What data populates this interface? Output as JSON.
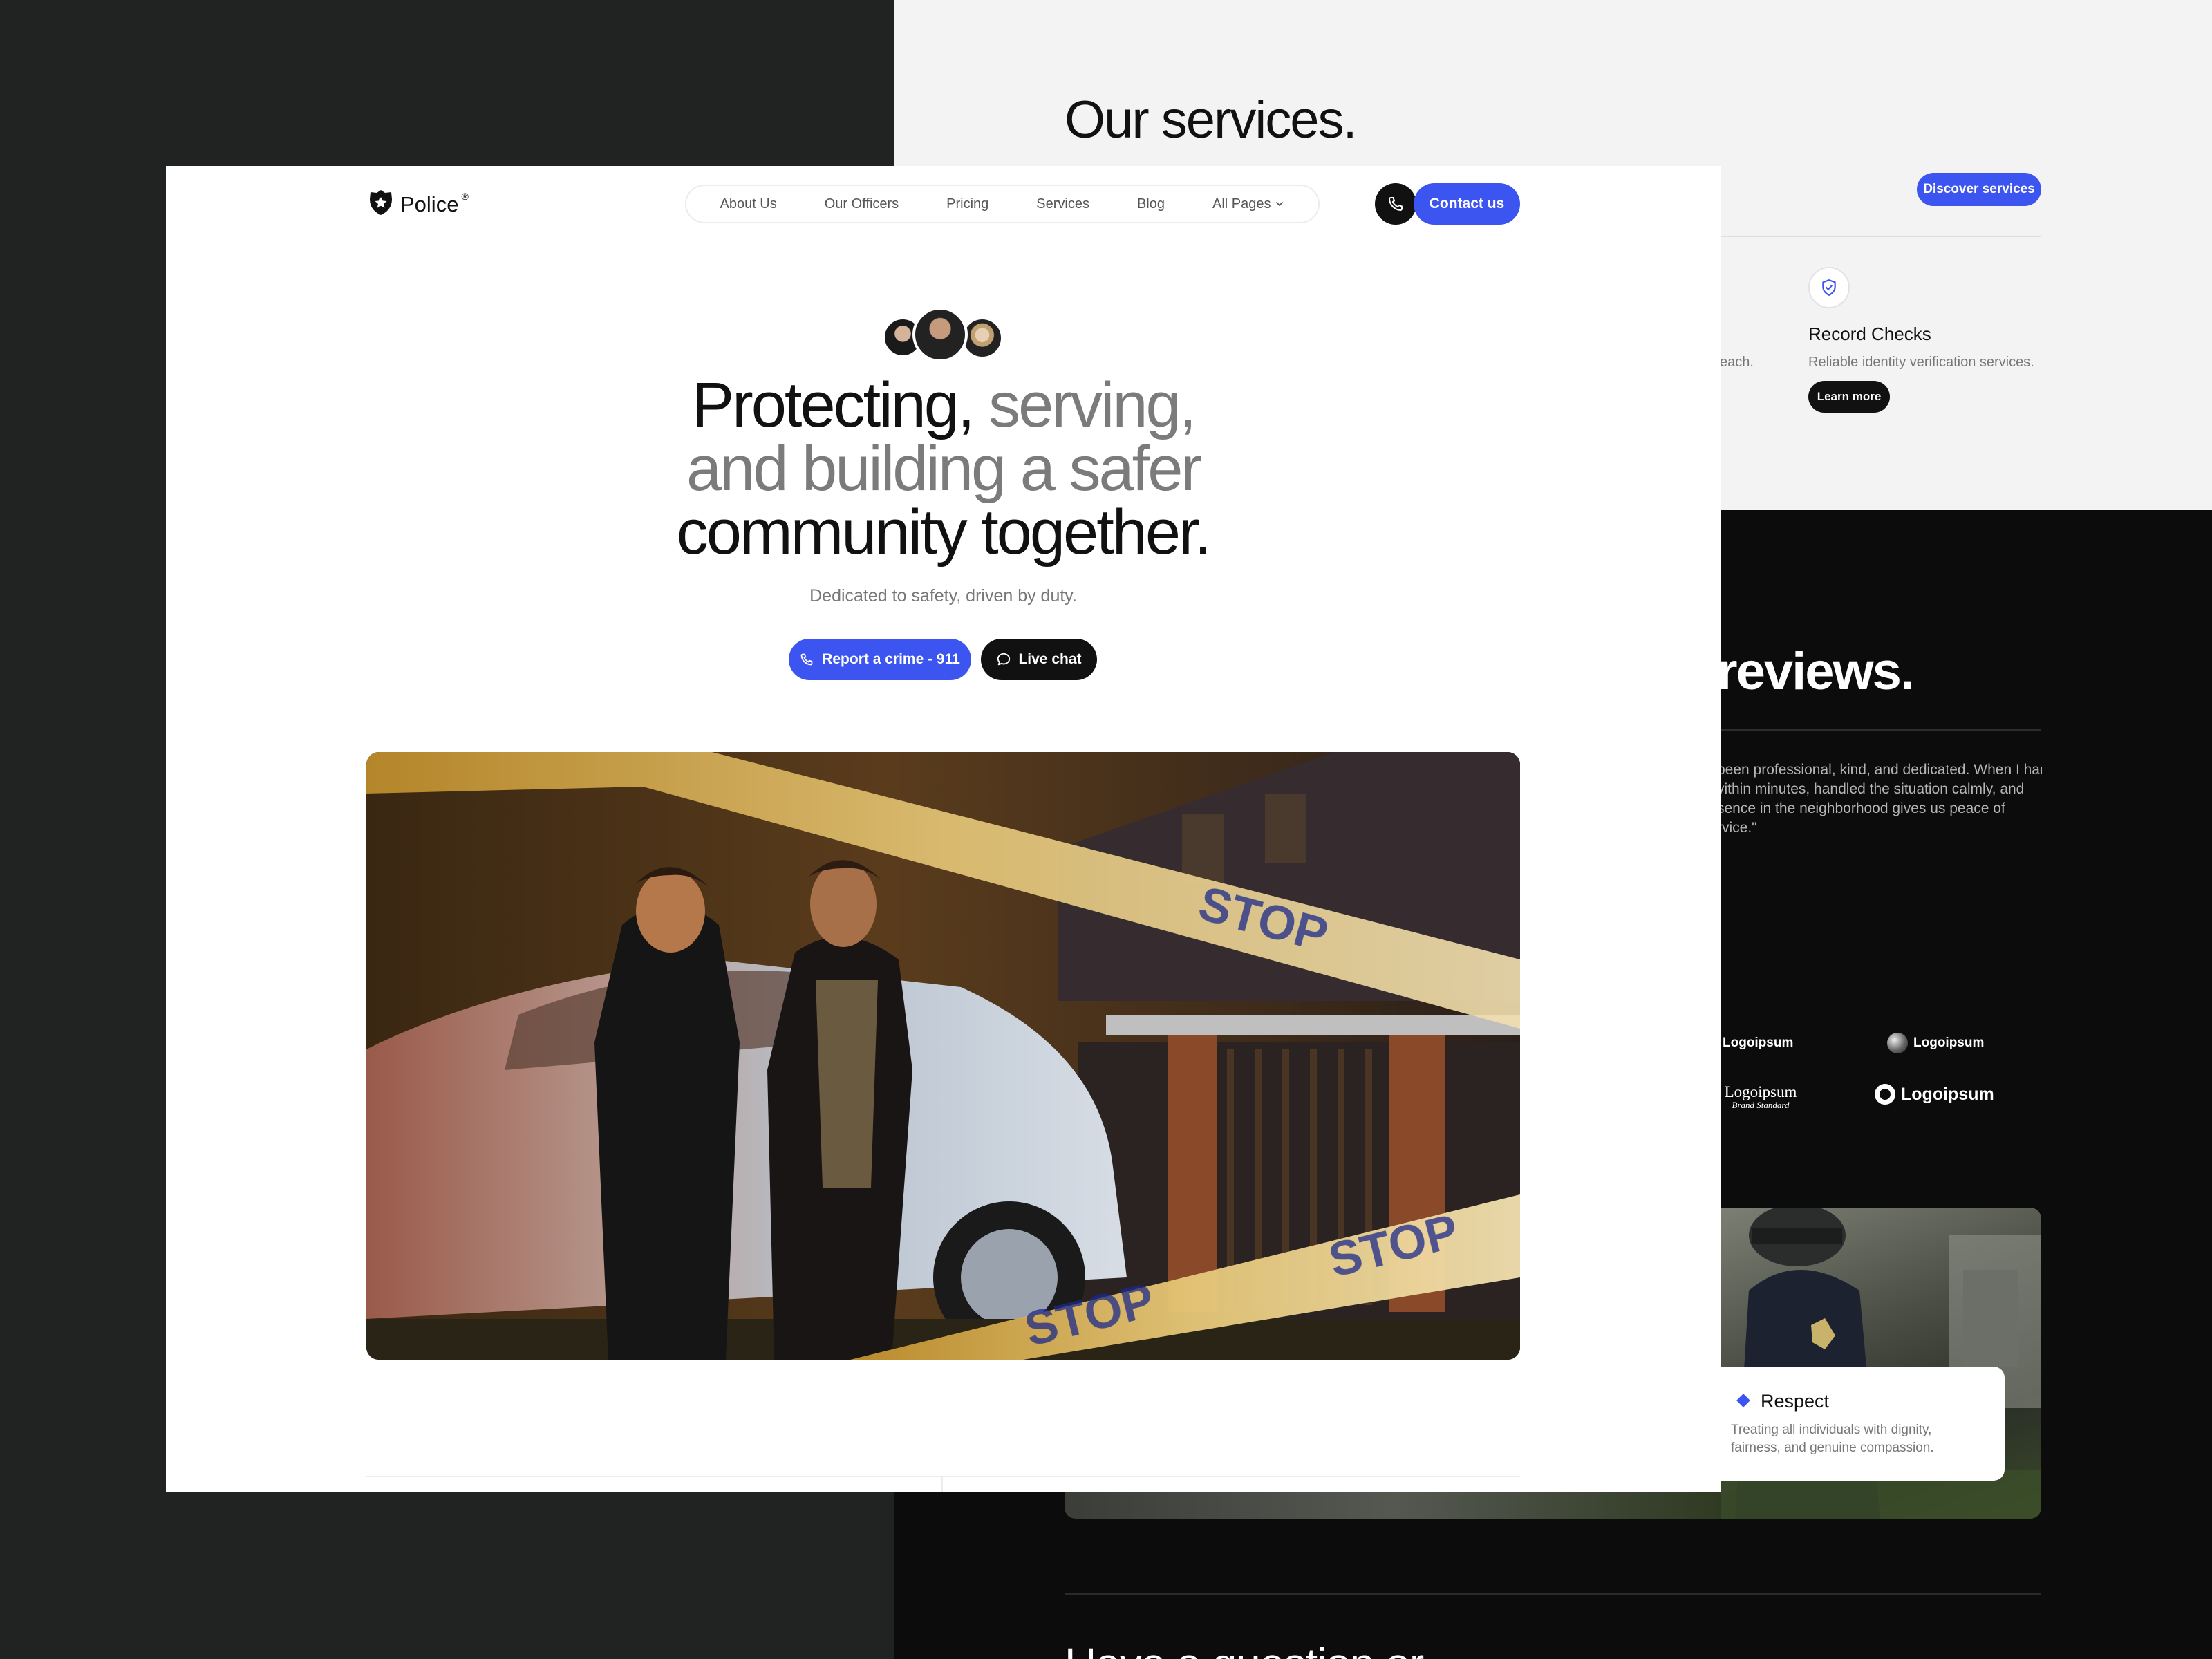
{
  "background": {
    "services": {
      "title": "Our services.",
      "discover_label": "Discover services",
      "partial_desc": "each.",
      "card": {
        "title": "Record Checks",
        "desc": "Reliable identity verification services.",
        "button": "Learn more",
        "icon": "shield-check-icon"
      }
    },
    "reviews": {
      "title": "reviews.",
      "text_lines": [
        "been professional, kind, and dedicated. When I had",
        "vithin minutes, handled the situation calmly, and",
        "sence in the neighborhood gives us peace of",
        "rvice.\""
      ]
    },
    "logos": {
      "logo1": "Logoipsum",
      "logo2": "Logoipsum",
      "logo3_main": "Logoipsum",
      "logo3_sub": "Brand Standard",
      "logo4": "Logoipsum"
    },
    "values": {
      "title": "Respect",
      "desc": "Treating all individuals with dignity, fairness, and genuine compassion."
    },
    "question": {
      "title": "Have a question or"
    }
  },
  "header": {
    "brand": "Police",
    "brand_mark": "®",
    "logo_icon": "police-badge-icon",
    "nav": [
      "About Us",
      "Our Officers",
      "Pricing",
      "Services",
      "Blog",
      "All Pages"
    ],
    "contact_label": "Contact us",
    "phone_icon": "phone-icon"
  },
  "hero": {
    "title_dark_1": "Protecting,",
    "title_grey_1": "serving,",
    "title_grey_2": "and building a safer",
    "title_dark_2": "community together.",
    "subtitle": "Dedicated to safety, driven by duty.",
    "report_label": "Report a crime - 911",
    "chat_label": "Live chat",
    "tape_text": "STOP"
  },
  "colors": {
    "accent": "#3d55f0",
    "dark": "#111111",
    "grey_text": "#7b7b7b"
  }
}
